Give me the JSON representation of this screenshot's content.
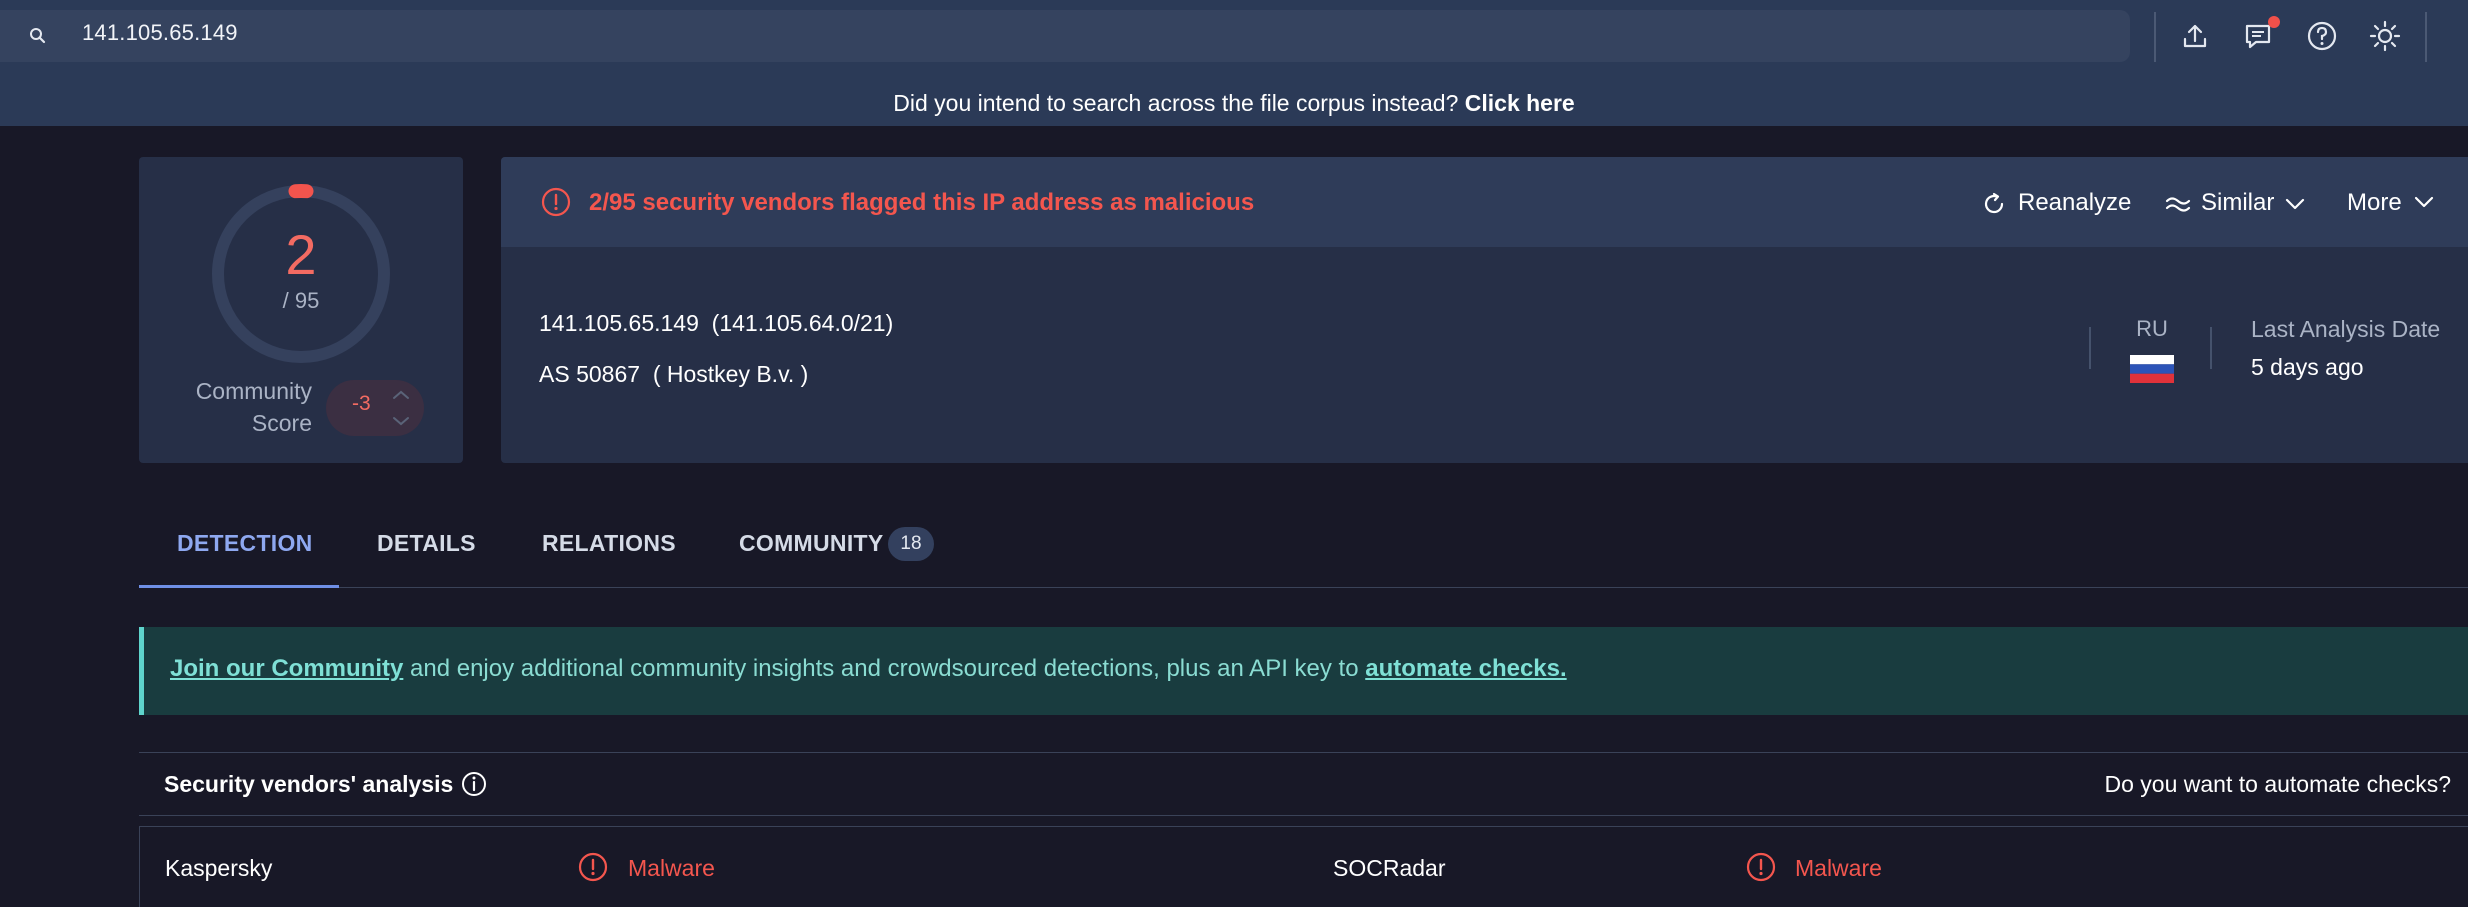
{
  "search": {
    "value": "141.105.65.149"
  },
  "banner": {
    "prefix": "Did you intend to search across the file corpus instead?",
    "link": "Click here"
  },
  "score": {
    "detections": "2",
    "total": "/ 95",
    "community_label_1": "Community",
    "community_label_2": "Score",
    "community_value": "-3"
  },
  "alert": {
    "text": "2/95 security vendors flagged this IP address as malicious"
  },
  "actions": {
    "reanalyze": "Reanalyze",
    "similar": "Similar",
    "more": "More"
  },
  "ip": {
    "address": "141.105.65.149",
    "network": "(141.105.64.0/21)",
    "as": "AS 50867",
    "owner": "( Hostkey B.v. )"
  },
  "meta": {
    "country": "RU",
    "last_analysis_label": "Last Analysis Date",
    "last_analysis_value": "5 days ago"
  },
  "tabs": [
    {
      "label": "DETECTION"
    },
    {
      "label": "DETAILS"
    },
    {
      "label": "RELATIONS"
    },
    {
      "label": "COMMUNITY",
      "count": "18"
    }
  ],
  "community_banner": {
    "link1": "Join our Community",
    "middle": " and enjoy additional community insights and crowdsourced detections, plus an API key to ",
    "link2": "automate checks."
  },
  "vendors": {
    "title": "Security vendors' analysis",
    "automate_prompt": "Do you want to automate checks?",
    "rows": [
      {
        "left_name": "Kaspersky",
        "left_result": "Malware",
        "right_name": "SOCRadar",
        "right_result": "Malware"
      }
    ]
  },
  "colors": {
    "malicious": "#f4564e",
    "accent": "#6f8fe6",
    "community": "#8adcd2"
  }
}
